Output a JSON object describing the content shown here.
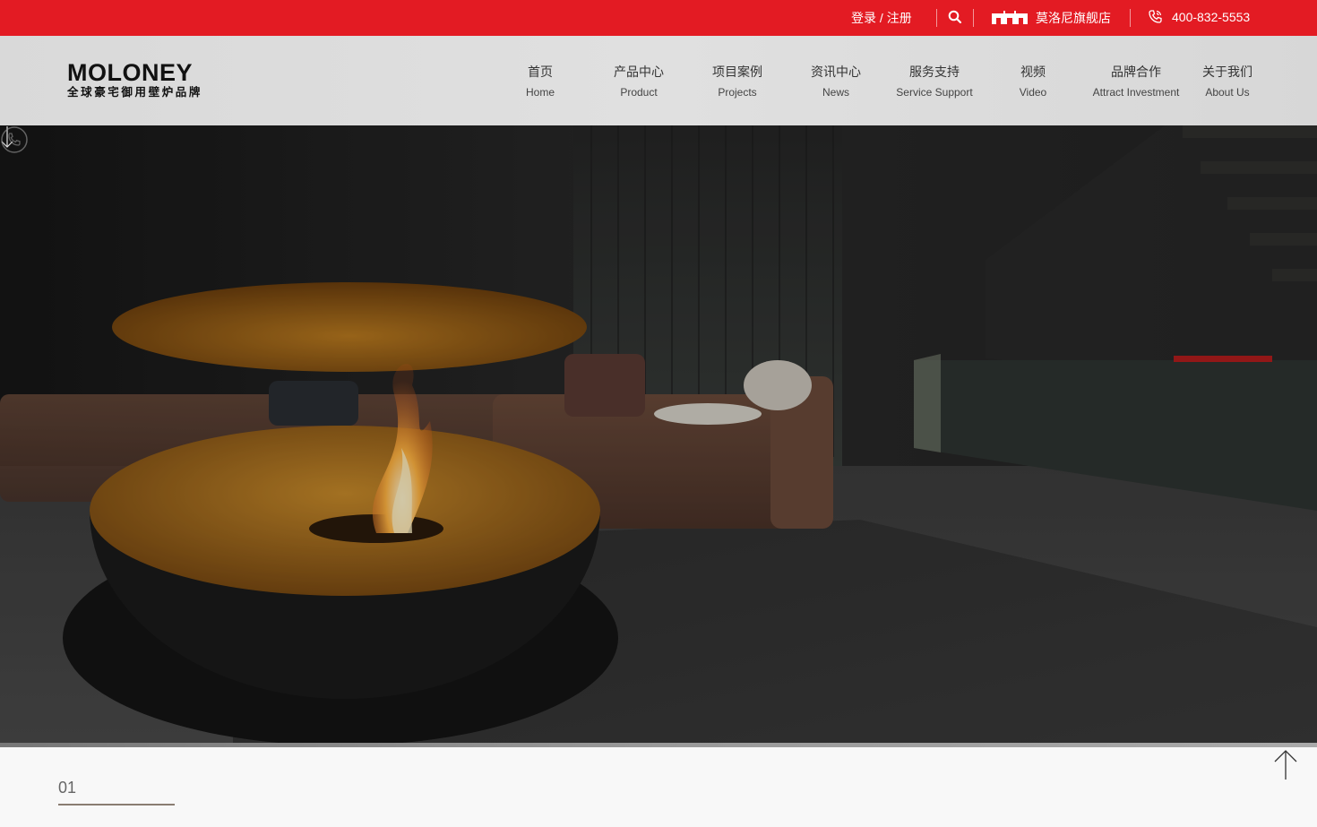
{
  "topbar": {
    "login_label": "登录 /",
    "register_label": "注册",
    "store_label": "莫洛尼旗舰店",
    "phone_number": "400-832-5553",
    "bg_color": "#e31b23"
  },
  "logo": {
    "brand": "MOLONEY",
    "tagline": "全球豪宅御用壁炉品牌"
  },
  "nav": [
    {
      "zh": "首页",
      "en": "Home"
    },
    {
      "zh": "产品中心",
      "en": "Product"
    },
    {
      "zh": "项目案例",
      "en": "Projects"
    },
    {
      "zh": "资讯中心",
      "en": "News"
    },
    {
      "zh": "服务支持",
      "en": "Service Support"
    },
    {
      "zh": "视频",
      "en": "Video"
    },
    {
      "zh": "品牌合作",
      "en": "Attract Investment"
    },
    {
      "zh": "关于我们",
      "en": "About Us"
    }
  ],
  "icons": {
    "search": "search-icon",
    "store": "tmall-icon",
    "phone": "phone-icon",
    "scroll": "arrow-down-icon",
    "back_to_top": "arrow-up-icon"
  },
  "section": {
    "number": "01"
  }
}
